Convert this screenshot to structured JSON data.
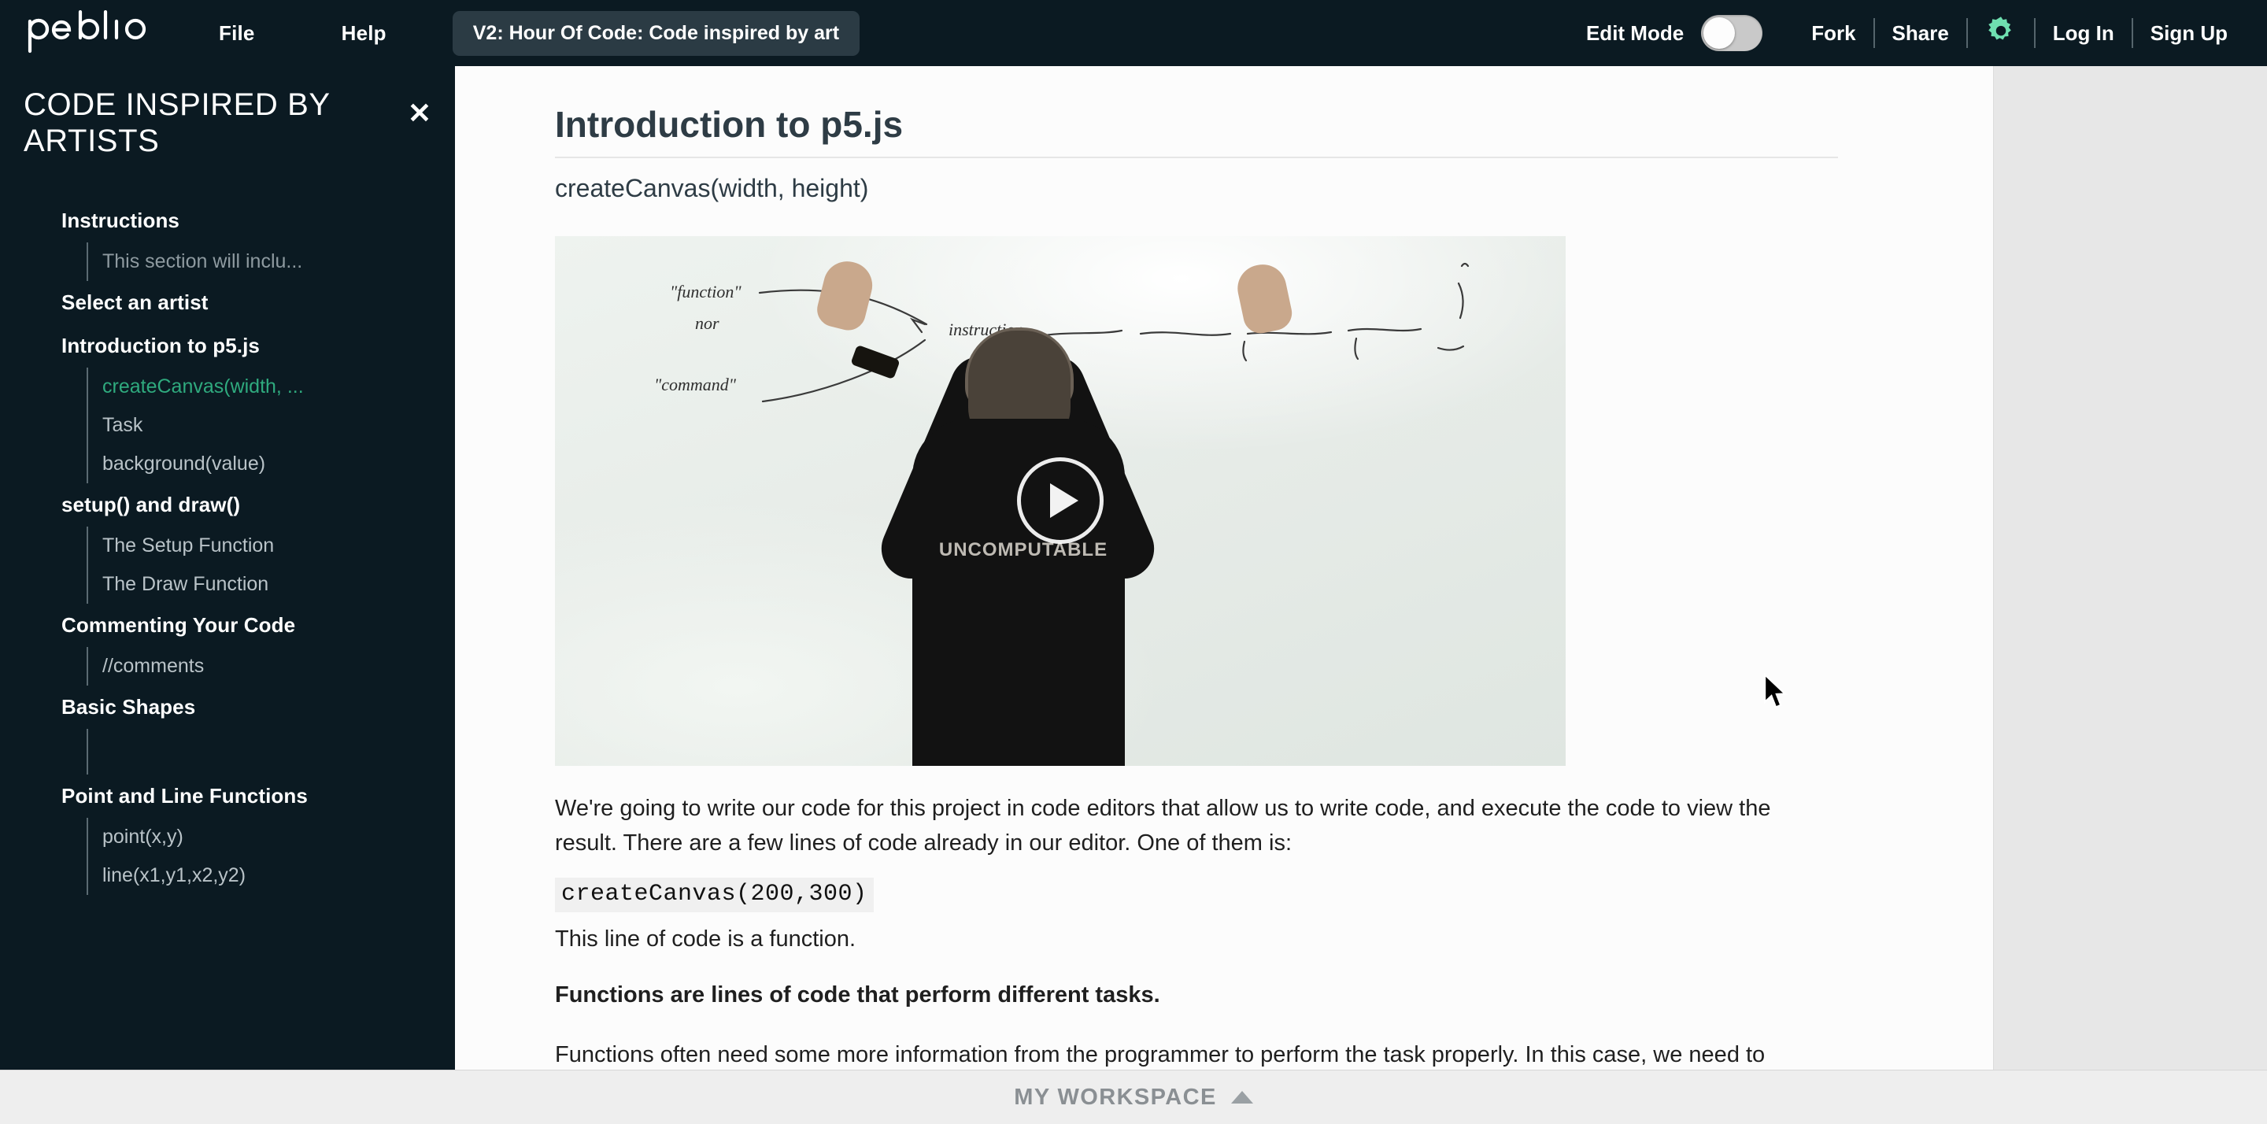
{
  "header": {
    "logo_text": "peblio",
    "logo_icon": "peblio-wordmark",
    "file_label": "File",
    "help_label": "Help",
    "doc_title": "V2: Hour Of Code: Code inspired by art",
    "edit_mode_label": "Edit Mode",
    "edit_mode_on": false,
    "fork_label": "Fork",
    "share_label": "Share",
    "gear_icon": "gear-icon",
    "gear_color": "#6fe0b0",
    "login_label": "Log In",
    "signup_label": "Sign Up",
    "bg_color": "#0b1a22"
  },
  "sidebar": {
    "title": "CODE INSPIRED BY ARTISTS",
    "close_icon": "close-icon",
    "active_color": "#2faa7e",
    "sections": [
      {
        "label": "Instructions",
        "items": [
          {
            "label": "This section will inclu...",
            "active": false
          }
        ]
      },
      {
        "label": "Select an artist",
        "items": []
      },
      {
        "label": "Introduction to p5.js",
        "items": [
          {
            "label": "createCanvas(width, ...",
            "active": true
          },
          {
            "label": "Task",
            "active": false
          },
          {
            "label": "background(value)",
            "active": false
          }
        ]
      },
      {
        "label": "setup() and draw()",
        "items": [
          {
            "label": "The Setup Function",
            "active": false
          },
          {
            "label": "The Draw Function",
            "active": false
          }
        ]
      },
      {
        "label": "Commenting Your Code",
        "items": [
          {
            "label": "//comments",
            "active": false
          }
        ]
      },
      {
        "label": "Basic Shapes",
        "items": []
      },
      {
        "label": "Point and Line Functions",
        "items": [
          {
            "label": "point(x,y)",
            "active": false
          },
          {
            "label": "line(x1,y1,x2,y2)",
            "active": false
          }
        ]
      }
    ]
  },
  "main": {
    "page_title": "Introduction to p5.js",
    "section_subtitle": "createCanvas(width, height)",
    "video": {
      "play_icon": "play-icon",
      "tee_text": "UNCOMPUTABLE",
      "whiteboard_notes": [
        "\"function\"",
        "nor",
        "\"command\"",
        "instruction"
      ]
    },
    "paragraph_1": "We're going to write our code for this project in code editors that allow us to write code, and execute the code to view the result. There are a few lines of code already in our editor. One of them is:",
    "code_snippet": "createCanvas(200,300)",
    "paragraph_2": "This line of code is a function.",
    "paragraph_3_bold": "Functions are lines of code that perform different tasks.",
    "paragraph_4": "Functions often need some more information from the programmer to perform the task properly. In this case, we need to"
  },
  "footer": {
    "workspace_label": "MY WORKSPACE",
    "caret_icon": "chevron-up-icon"
  }
}
